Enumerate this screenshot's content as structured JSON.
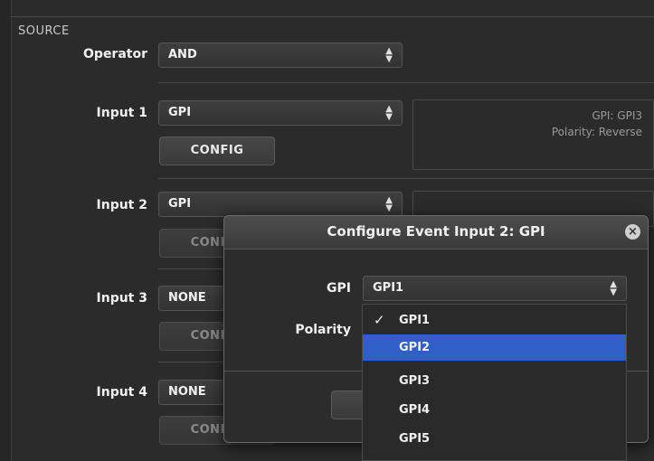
{
  "source": {
    "section_label": "SOURCE",
    "operator": {
      "label": "Operator",
      "value": "AND"
    },
    "inputs": [
      {
        "label": "Input 1",
        "value": "GPI",
        "config": "CONFIG",
        "info_line1": "GPI: GPI3",
        "info_line2": "Polarity: Reverse"
      },
      {
        "label": "Input 2",
        "value": "GPI",
        "config": "CONFIG"
      },
      {
        "label": "Input 3",
        "value": "NONE",
        "config": "CONFIG"
      },
      {
        "label": "Input 4",
        "value": "NONE",
        "config": "CONFIG"
      }
    ]
  },
  "dialog": {
    "title": "Configure Event Input 2: GPI",
    "gpi_label": "GPI",
    "gpi_value": "GPI1",
    "polarity_label": "Polarity",
    "dropdown_options": [
      "GPI1",
      "GPI2",
      "GPI3",
      "GPI4",
      "GPI5"
    ],
    "checked_option": "GPI1",
    "highlighted_option": "GPI2"
  },
  "icons": {
    "select_arrows": "up-down-arrows-icon",
    "close": "close-icon",
    "check": "checkmark-icon"
  },
  "colors": {
    "highlight": "#2f5fc7",
    "background": "#2b2b2b"
  }
}
